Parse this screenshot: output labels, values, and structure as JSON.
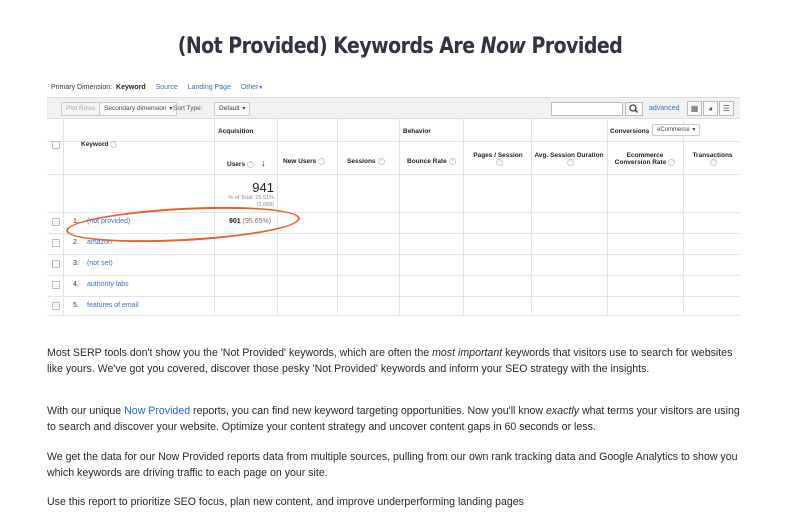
{
  "title": {
    "before": "(Not Provided) Keywords Are ",
    "emph": "Now",
    "after": " Provided"
  },
  "primary_dimension": {
    "label": "Primary Dimension:",
    "selected": "Keyword",
    "links": [
      "Source",
      "Landing Page",
      "Other"
    ]
  },
  "toolbar": {
    "plot_rows": "Plot Rows",
    "secondary_dimension": "Secondary dimension",
    "sort_type_label": "Sort Type:",
    "sort_type_value": "Default",
    "advanced": "advanced"
  },
  "icons": {
    "search": "search-icon",
    "grid": "grid-view-icon",
    "pie": "pie-view-icon",
    "bars": "bar-view-icon",
    "question": "question-icon",
    "caret": "caret-down-icon",
    "sort": "sort-arrow-icon"
  },
  "table": {
    "keyword_header": "Keyword",
    "groups": {
      "acquisition": "Acquisition",
      "behavior": "Behavior",
      "conversions": "Conversions",
      "conversions_select": "eCommerce"
    },
    "columns": {
      "users": "Users",
      "new_users": "New Users",
      "sessions": "Sessions",
      "bounce_rate": "Bounce Rate",
      "pages_session": "Pages / Session",
      "avg_duration": "Avg. Session Duration",
      "ecommerce_rate": "Ecommerce Conversion Rate",
      "transactions": "Transactions"
    },
    "totals": {
      "users": "941",
      "users_pct_line1": "% of Total: 25.51%",
      "users_pct_line2": "(3,689)"
    },
    "rows": [
      {
        "index": "1.",
        "keyword": "(not provided)",
        "users": "901",
        "users_pct": "(95.65%)"
      },
      {
        "index": "2.",
        "keyword": "amazon",
        "users": "",
        "users_pct": ""
      },
      {
        "index": "3.",
        "keyword": "(not set)",
        "users": "",
        "users_pct": ""
      },
      {
        "index": "4.",
        "keyword": "authority labs",
        "users": "",
        "users_pct": ""
      },
      {
        "index": "5.",
        "keyword": "features of email",
        "users": "",
        "users_pct": ""
      }
    ]
  },
  "paragraphs": {
    "p1_a": "Most SERP tools don't show you the 'Not Provided' keywords, which are often the ",
    "p1_em": "most important",
    "p1_b": " keywords that visitors use to search for websites like yours. We've got you covered, discover those pesky 'Not Provided' keywords and inform your SEO strategy with the insights.",
    "p2_a": "With our unique ",
    "p2_link": "Now Provided",
    "p2_b": " reports, you can find new keyword targeting opportunities. Now you'll know ",
    "p2_em": "exactly",
    "p2_c": " what terms your visitors are using to search and discover your website. Optimize your content strategy and uncover content gaps in 60 seconds or less.",
    "p3": "We get the data for our Now Provided reports data from multiple sources, pulling from our own rank tracking data and Google Analytics to show you which keywords are driving traffic to each page on your site.",
    "p4": "Use this report to prioritize SEO focus, plan new content, and improve underperforming landing pages"
  },
  "colors": {
    "link": "#3a6fc4",
    "highlight_circle": "#e9602a",
    "title": "#2f3440"
  }
}
